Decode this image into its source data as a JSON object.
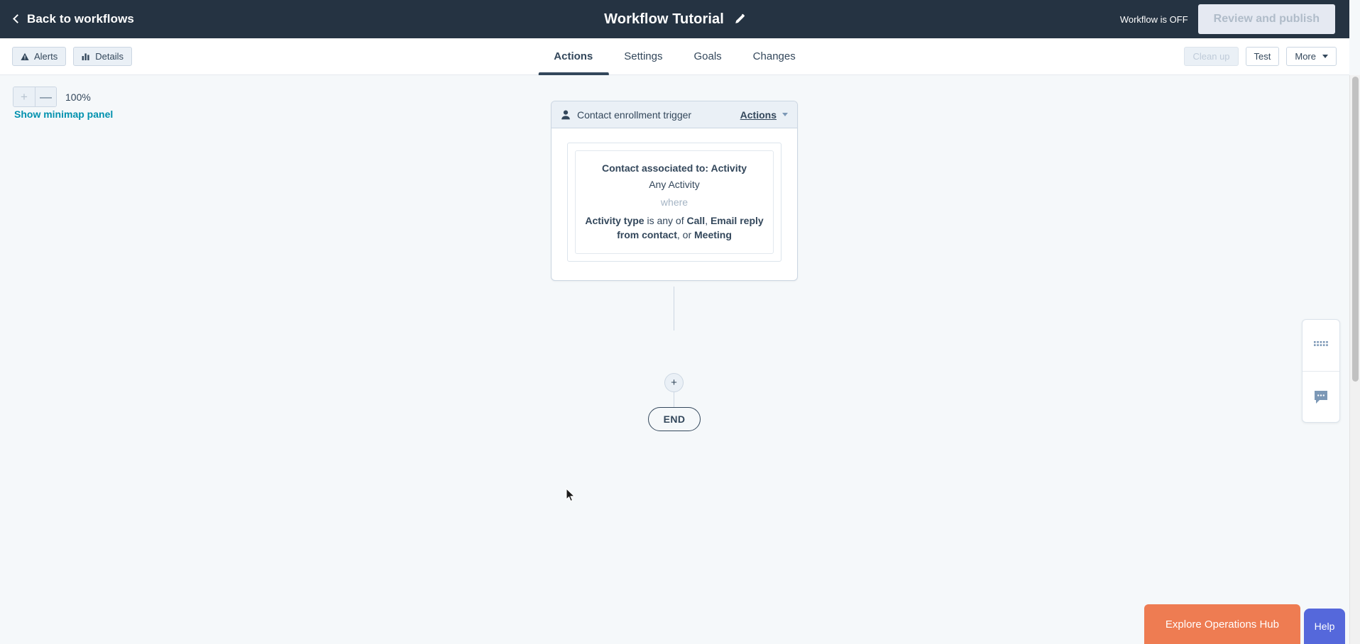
{
  "topbar": {
    "back_label": "Back to workflows",
    "back_icon": "chevron-left-icon",
    "title": "Workflow Tutorial",
    "edit_icon": "pencil-icon",
    "status_text": "Workflow is OFF",
    "publish_label": "Review and publish"
  },
  "subbar": {
    "alerts_label": "Alerts",
    "alerts_icon": "warning-triangle-icon",
    "details_label": "Details",
    "details_icon": "bar-chart-icon",
    "tabs": [
      {
        "label": "Actions",
        "active": true
      },
      {
        "label": "Settings",
        "active": false
      },
      {
        "label": "Goals",
        "active": false
      },
      {
        "label": "Changes",
        "active": false
      }
    ],
    "cleanup_label": "Clean up",
    "test_label": "Test",
    "more_label": "More"
  },
  "canvas": {
    "zoom_in_label": "+",
    "zoom_out_label": "—",
    "zoom_level": "100%",
    "minimap_label": "Show minimap panel"
  },
  "trigger": {
    "header_label": "Contact enrollment trigger",
    "header_icon": "contact-person-icon",
    "actions_label": "Actions",
    "filter": {
      "association": "Contact associated to: Activity",
      "object": "Any Activity",
      "where": "where",
      "condition_property": "Activity type",
      "condition_operator": "is any of",
      "condition_value_1": "Call",
      "condition_sep_1": ", ",
      "condition_value_2": "Email reply from contact",
      "condition_sep_2": ", or ",
      "condition_value_3": "Meeting"
    }
  },
  "flow": {
    "add_step_label": "+",
    "end_label": "END"
  },
  "side_panel": {
    "apps_icon": "apps-grid-icon",
    "chat_icon": "chat-bubble-icon"
  },
  "footer": {
    "ops_hub_label": "Explore Operations Hub",
    "help_label": "Help"
  },
  "colors": {
    "nav_dark": "#253342",
    "accent_teal": "#0091AE",
    "ops_orange": "#EE7C52",
    "help_purple": "#5568DB",
    "canvas_bg": "#F5F8FA",
    "panel_grey": "#EAF0F6",
    "border_grey": "#CBD6E2",
    "text_dark": "#33475B"
  }
}
